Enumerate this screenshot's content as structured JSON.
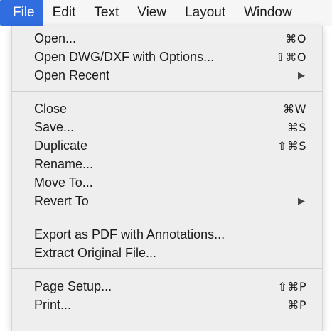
{
  "menubar": {
    "items": [
      {
        "label": "File"
      },
      {
        "label": "Edit"
      },
      {
        "label": "Text"
      },
      {
        "label": "View"
      },
      {
        "label": "Layout"
      },
      {
        "label": "Window"
      }
    ]
  },
  "file_menu": {
    "items": [
      {
        "label": "Open...",
        "shortcut": "⌘O"
      },
      {
        "label": "Open DWG/DXF with Options...",
        "shortcut": "⇧⌘O"
      },
      {
        "label": "Open Recent",
        "submenu_arrow": "▶"
      },
      {
        "label": "Close",
        "shortcut": "⌘W"
      },
      {
        "label": "Save...",
        "shortcut": "⌘S"
      },
      {
        "label": "Duplicate",
        "shortcut": "⇧⌘S"
      },
      {
        "label": "Rename..."
      },
      {
        "label": "Move To..."
      },
      {
        "label": "Revert To",
        "submenu_arrow": "▶"
      },
      {
        "label": "Export as PDF with Annotations..."
      },
      {
        "label": "Extract Original File..."
      },
      {
        "label": "Page Setup...",
        "shortcut": "⇧⌘P"
      },
      {
        "label": "Print...",
        "shortcut": "⌘P"
      }
    ]
  },
  "colors": {
    "accent": "#2f6de0",
    "menu_background": "#eeeeee",
    "menubar_background": "#f6f6f6"
  }
}
